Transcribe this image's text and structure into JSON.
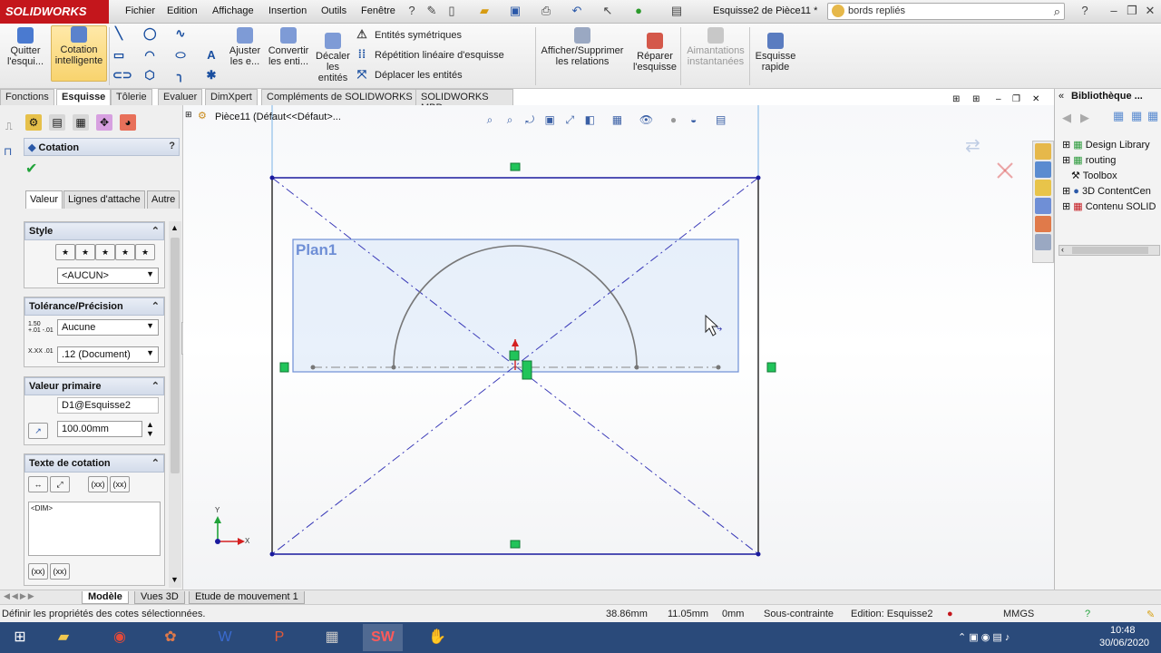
{
  "app": {
    "logo": "SOLIDWORKS",
    "doc_title": "Esquisse2 de Pièce11 *"
  },
  "menu": [
    "Fichier",
    "Edition",
    "Affichage",
    "Insertion",
    "Outils",
    "Fenêtre"
  ],
  "search": {
    "value": "bords repliés"
  },
  "ribbon": {
    "exit_sketch": "Quitter l'esqui...",
    "smart_dim": "Cotation intelligente",
    "trim": "Ajuster les e...",
    "convert": "Convertir les enti...",
    "offset": "Décaler les entités",
    "mirror": "Entités symétriques",
    "linear_pattern": "Répétition linéaire d'esquisse",
    "move": "Déplacer les entités",
    "relations": "Afficher/Supprimer les relations",
    "repair": "Réparer l'esquisse",
    "snaps": "Aimantations instantanées",
    "quick_sketch": "Esquisse rapide"
  },
  "tabs": [
    "Fonctions",
    "Esquisse",
    "Tôlerie",
    "Evaluer",
    "DimXpert",
    "Compléments de SOLIDWORKS",
    "SOLIDWORKS MBD"
  ],
  "tree": {
    "root": "Pièce11  (Défaut<<Défaut>..."
  },
  "property_manager": {
    "title": "Cotation",
    "help": "?",
    "tabs": [
      "Valeur",
      "Lignes d'attache",
      "Autre"
    ],
    "style": {
      "header": "Style",
      "value": "<AUCUN>"
    },
    "tolerance": {
      "header": "Tolérance/Précision",
      "type": "Aucune",
      "precision": ".12 (Document)",
      "tol_sample": "1.50 +.01 -.01",
      "prec_sample": "X.XX .01"
    },
    "primary": {
      "header": "Valeur primaire",
      "name": "D1@Esquisse2",
      "value": "100.00mm"
    },
    "dim_text": {
      "header": "Texte de cotation",
      "text": "<DIM>",
      "btn1": "(xx)",
      "btn2": "(xx)",
      "btn3": "(xx)",
      "btn4": "(xx)"
    }
  },
  "sketch": {
    "plane_label": "Plan1",
    "axis_x": "X",
    "axis_y": "Y"
  },
  "library": {
    "title": "Bibliothèque ...",
    "items": [
      "Design Library",
      "routing",
      "Toolbox",
      "3D ContentCen",
      "Contenu SOLID"
    ]
  },
  "bottom_tabs": [
    "Modèle",
    "Vues 3D",
    "Etude de mouvement 1"
  ],
  "status": {
    "message": "Définir les propriétés des cotes sélectionnées.",
    "x": "38.86mm",
    "y": "11.05mm",
    "z": "0mm",
    "state": "Sous-contrainte",
    "editing": "Edition: Esquisse2",
    "units": "MMGS"
  },
  "taskbar": {
    "time": "10:48",
    "date": "30/06/2020"
  },
  "colors": {
    "accent": "#c4161c",
    "sketch_line": "#1a1a9e",
    "plane_fill": "#cfe0f7",
    "handle": "#21c45a"
  }
}
